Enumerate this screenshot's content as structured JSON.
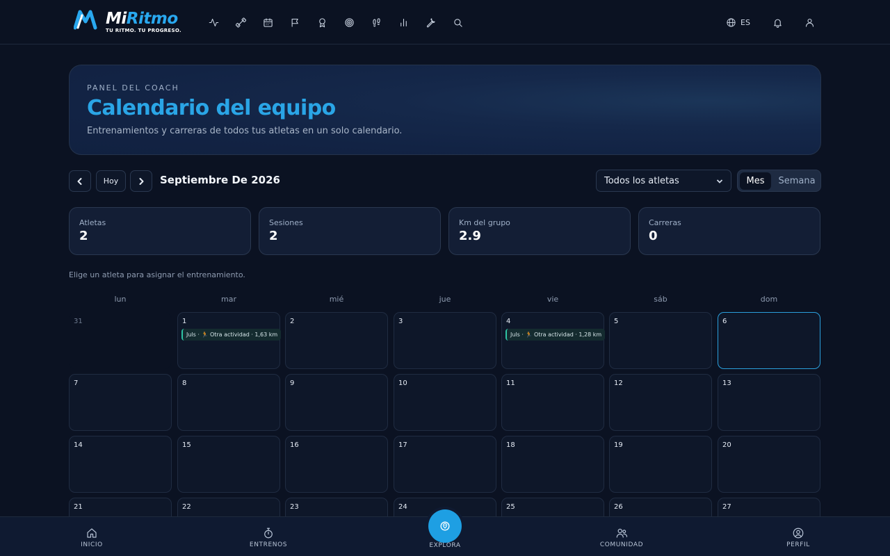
{
  "brand": {
    "name_part1": "Mi",
    "name_part2": "Ritmo",
    "tagline": "TU RITMO. TU PROGRESO.",
    "accent_color": "#29a8ef"
  },
  "topnav": {
    "icons": [
      "activity-icon",
      "workouts-icon",
      "calendar-icon",
      "flag-icon",
      "award-icon",
      "target-icon",
      "footprints-icon",
      "stats-icon",
      "tools-icon",
      "search-icon"
    ],
    "language": "ES"
  },
  "hero": {
    "kicker": "PANEL DEL COACH",
    "title": "Calendario del equipo",
    "subtitle": "Entrenamientos y carreras de todos tus atletas en un solo calendario."
  },
  "toolbar": {
    "today_label": "Hoy",
    "month_label": "Septiembre De 2026",
    "athlete_filter": "Todos los atletas",
    "view_month": "Mes",
    "view_week": "Semana"
  },
  "stats": [
    {
      "label": "Atletas",
      "value": "2"
    },
    {
      "label": "Sesiones",
      "value": "2"
    },
    {
      "label": "Km del grupo",
      "value": "2.9"
    },
    {
      "label": "Carreras",
      "value": "0"
    }
  ],
  "hint": "Elige un atleta para asignar el entrenamiento.",
  "calendar": {
    "weekdays": [
      "lun",
      "mar",
      "mié",
      "jue",
      "vie",
      "sáb",
      "dom"
    ],
    "days": [
      "31",
      "1",
      "2",
      "3",
      "4",
      "5",
      "6",
      "7",
      "8",
      "9",
      "10",
      "11",
      "12",
      "13",
      "14",
      "15",
      "16",
      "17",
      "18",
      "19",
      "20",
      "21",
      "22",
      "23",
      "24",
      "25",
      "26",
      "27"
    ],
    "events": [
      {
        "day": "1",
        "text": "Juls · 🏃 Otra actividad · 1,63 km"
      },
      {
        "day": "4",
        "text": "Juls · 🏃 Otra actividad · 1,28 km"
      }
    ],
    "today": "6",
    "event_color": "#2ec4a4",
    "today_color": "#2ba0dd"
  },
  "bottom_nav": {
    "home": "INICIO",
    "workouts": "ENTRENOS",
    "explore": "EXPLORA",
    "community": "COMUNIDAD",
    "profile": "PERFIL"
  }
}
